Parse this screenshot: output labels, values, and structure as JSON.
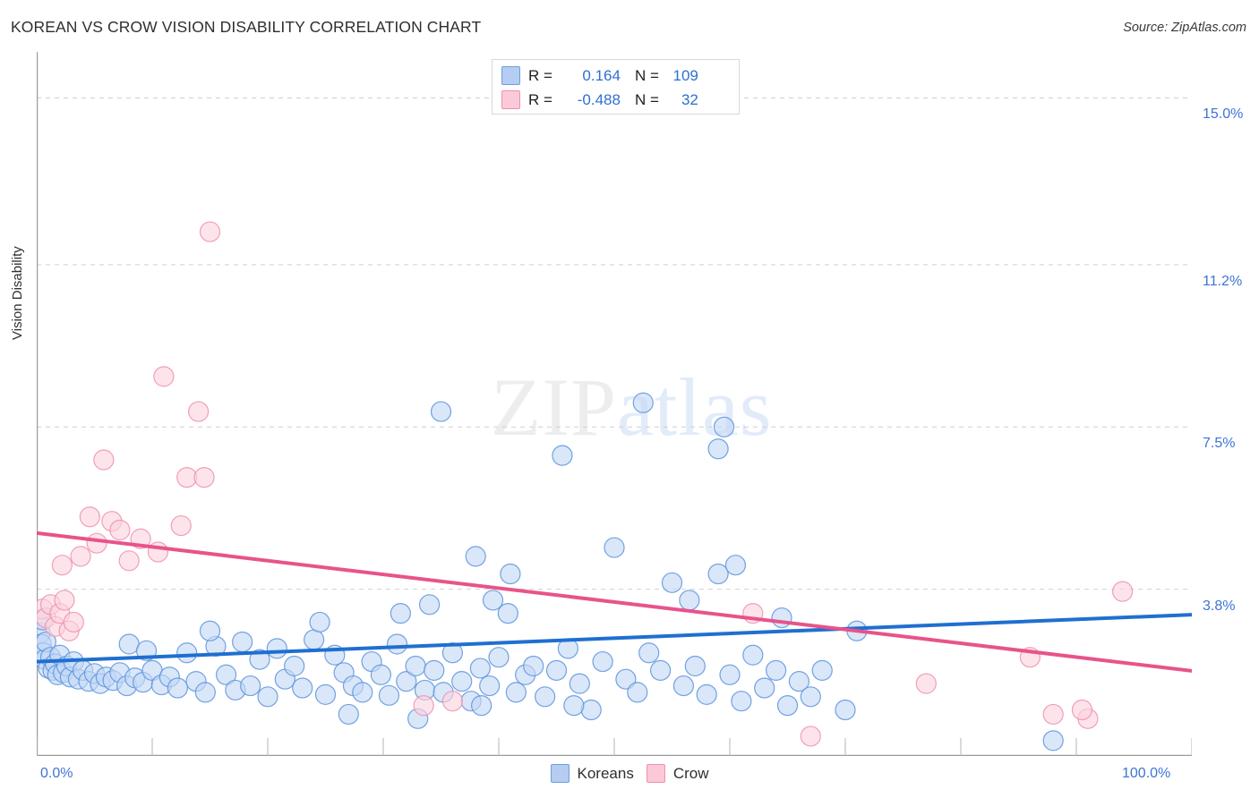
{
  "header": {
    "title": "KOREAN VS CROW VISION DISABILITY CORRELATION CHART",
    "source": "Source: ZipAtlas.com"
  },
  "watermark": {
    "part1": "ZIP",
    "part2": "atlas"
  },
  "stats_legend": {
    "rows": [
      {
        "series": "Koreans",
        "r_label": "R =",
        "r_value": "0.164",
        "n_label": "N =",
        "n_value": "109",
        "color": "#b5cdf0"
      },
      {
        "series": "Crow",
        "r_label": "R =",
        "r_value": "-0.488",
        "n_label": "N =",
        "n_value": "32",
        "color": "#fbc9d8"
      }
    ]
  },
  "bottom_legend": {
    "items": [
      {
        "label": "Koreans",
        "color": "#b5cdf0",
        "border": "#6f9de0"
      },
      {
        "label": "Crow",
        "color": "#fbc9d8",
        "border": "#ee91ad"
      }
    ]
  },
  "chart_data": {
    "type": "scatter",
    "title": "KOREAN VS CROW VISION DISABILITY CORRELATION CHART",
    "xlabel": "",
    "ylabel": "Vision Disability",
    "xlim": [
      0,
      100
    ],
    "ylim": [
      0,
      16.05
    ],
    "grid": true,
    "legend_position": "bottom-center",
    "x_tick_labels": [
      "0.0%",
      "100.0%"
    ],
    "y_tick_labels": [
      "3.8%",
      "7.5%",
      "11.2%",
      "15.0%"
    ],
    "y_tick_values": [
      3.8,
      7.5,
      11.2,
      15.0
    ],
    "series": [
      {
        "name": "Koreans",
        "color": "#c3d9f5",
        "edge": "#5b93dd",
        "r": 0.164,
        "n": 109,
        "trendline": {
          "x0": 0,
          "y0": 2.15,
          "x1": 100,
          "y1": 3.22,
          "color": "#1f6fd0"
        },
        "points": [
          [
            0.3,
            2.8
          ],
          [
            0.4,
            2.55
          ],
          [
            0.5,
            3.1
          ],
          [
            0.6,
            2.35
          ],
          [
            0.7,
            2.2
          ],
          [
            0.8,
            2.6
          ],
          [
            1.0,
            2.0
          ],
          [
            1.2,
            2.25
          ],
          [
            1.4,
            1.95
          ],
          [
            1.6,
            2.1
          ],
          [
            1.8,
            1.85
          ],
          [
            2.0,
            2.3
          ],
          [
            2.3,
            1.9
          ],
          [
            2.6,
            2.05
          ],
          [
            2.9,
            1.8
          ],
          [
            3.2,
            2.15
          ],
          [
            3.6,
            1.75
          ],
          [
            4.0,
            1.95
          ],
          [
            4.5,
            1.7
          ],
          [
            5.0,
            1.88
          ],
          [
            5.5,
            1.65
          ],
          [
            6.0,
            1.8
          ],
          [
            6.6,
            1.72
          ],
          [
            7.2,
            1.9
          ],
          [
            7.8,
            1.6
          ],
          [
            8.5,
            1.78
          ],
          [
            9.2,
            1.68
          ],
          [
            10.0,
            1.95
          ],
          [
            10.8,
            1.62
          ],
          [
            8.0,
            2.55
          ],
          [
            9.5,
            2.4
          ],
          [
            11.5,
            1.8
          ],
          [
            12.2,
            1.55
          ],
          [
            13.0,
            2.35
          ],
          [
            13.8,
            1.7
          ],
          [
            14.6,
            1.45
          ],
          [
            15.5,
            2.5
          ],
          [
            16.4,
            1.85
          ],
          [
            17.2,
            1.5
          ],
          [
            15.0,
            2.85
          ],
          [
            17.8,
            2.6
          ],
          [
            18.5,
            1.6
          ],
          [
            19.3,
            2.2
          ],
          [
            20.0,
            1.35
          ],
          [
            20.8,
            2.45
          ],
          [
            21.5,
            1.75
          ],
          [
            22.3,
            2.05
          ],
          [
            23.0,
            1.55
          ],
          [
            24.0,
            2.65
          ],
          [
            25.0,
            1.4
          ],
          [
            25.8,
            2.3
          ],
          [
            26.6,
            1.9
          ],
          [
            27.4,
            1.6
          ],
          [
            24.5,
            3.05
          ],
          [
            28.2,
            1.45
          ],
          [
            29.0,
            2.15
          ],
          [
            29.8,
            1.85
          ],
          [
            30.5,
            1.38
          ],
          [
            31.2,
            2.55
          ],
          [
            27.0,
            0.95
          ],
          [
            32.0,
            1.7
          ],
          [
            32.8,
            2.05
          ],
          [
            33.6,
            1.5
          ],
          [
            34.4,
            1.95
          ],
          [
            31.5,
            3.25
          ],
          [
            35.2,
            1.45
          ],
          [
            36.0,
            2.35
          ],
          [
            36.8,
            1.7
          ],
          [
            33.0,
            0.85
          ],
          [
            37.6,
            1.25
          ],
          [
            38.4,
            2.0
          ],
          [
            34.0,
            3.45
          ],
          [
            35.0,
            7.85
          ],
          [
            39.2,
            1.6
          ],
          [
            40.0,
            2.25
          ],
          [
            40.8,
            3.25
          ],
          [
            41.5,
            1.45
          ],
          [
            38.0,
            4.55
          ],
          [
            42.3,
            1.85
          ],
          [
            43.0,
            2.05
          ],
          [
            39.5,
            3.55
          ],
          [
            44.0,
            1.35
          ],
          [
            45.0,
            1.95
          ],
          [
            41.0,
            4.15
          ],
          [
            46.0,
            2.45
          ],
          [
            47.0,
            1.65
          ],
          [
            38.5,
            1.15
          ],
          [
            48.0,
            1.05
          ],
          [
            49.0,
            2.15
          ],
          [
            50.0,
            4.75
          ],
          [
            51.0,
            1.75
          ],
          [
            45.5,
            6.85
          ],
          [
            52.0,
            1.45
          ],
          [
            53.0,
            2.35
          ],
          [
            54.0,
            1.95
          ],
          [
            46.5,
            1.15
          ],
          [
            55.0,
            3.95
          ],
          [
            56.0,
            1.6
          ],
          [
            57.0,
            2.05
          ],
          [
            52.5,
            8.05
          ],
          [
            58.0,
            1.4
          ],
          [
            59.0,
            4.15
          ],
          [
            60.0,
            1.85
          ],
          [
            61.0,
            1.25
          ],
          [
            62.0,
            2.3
          ],
          [
            63.0,
            1.55
          ],
          [
            56.5,
            3.55
          ],
          [
            64.0,
            1.95
          ],
          [
            65.0,
            1.15
          ],
          [
            59.5,
            7.5
          ],
          [
            59.0,
            7.0
          ],
          [
            66.0,
            1.7
          ],
          [
            67.0,
            1.35
          ],
          [
            60.5,
            4.35
          ],
          [
            64.5,
            3.15
          ],
          [
            68.0,
            1.95
          ],
          [
            70.0,
            1.05
          ],
          [
            71.0,
            2.85
          ],
          [
            88.0,
            0.35
          ]
        ]
      },
      {
        "name": "Crow",
        "color": "#fcd3de",
        "edge": "#ef8fae",
        "r": -0.488,
        "n": 32,
        "trendline": {
          "x0": 0,
          "y0": 5.08,
          "x1": 100,
          "y1": 1.94,
          "color": "#e8538a"
        },
        "points": [
          [
            0.5,
            3.35
          ],
          [
            0.8,
            3.15
          ],
          [
            1.2,
            3.45
          ],
          [
            1.6,
            2.95
          ],
          [
            2.0,
            3.25
          ],
          [
            2.4,
            3.55
          ],
          [
            2.8,
            2.85
          ],
          [
            3.2,
            3.05
          ],
          [
            2.2,
            4.35
          ],
          [
            3.8,
            4.55
          ],
          [
            4.6,
            5.45
          ],
          [
            5.2,
            4.85
          ],
          [
            5.8,
            6.75
          ],
          [
            6.5,
            5.35
          ],
          [
            7.2,
            5.15
          ],
          [
            8.0,
            4.45
          ],
          [
            9.0,
            4.95
          ],
          [
            10.5,
            4.65
          ],
          [
            11.0,
            8.65
          ],
          [
            12.5,
            5.25
          ],
          [
            14.0,
            7.85
          ],
          [
            15.0,
            11.95
          ],
          [
            13.0,
            6.35
          ],
          [
            14.5,
            6.35
          ],
          [
            33.5,
            1.15
          ],
          [
            36.0,
            1.25
          ],
          [
            62.0,
            3.25
          ],
          [
            67.0,
            0.45
          ],
          [
            77.0,
            1.65
          ],
          [
            86.0,
            2.25
          ],
          [
            88.0,
            0.95
          ],
          [
            91.0,
            0.85
          ],
          [
            94.0,
            3.75
          ],
          [
            90.5,
            1.05
          ]
        ]
      }
    ]
  },
  "axis": {
    "y_labels": [
      {
        "text": "15.0%",
        "value": 15.0
      },
      {
        "text": "11.2%",
        "value": 11.2
      },
      {
        "text": "7.5%",
        "value": 7.5
      },
      {
        "text": "3.8%",
        "value": 3.8
      }
    ],
    "x_labels": [
      {
        "text": "0.0%",
        "value": 0
      },
      {
        "text": "100.0%",
        "value": 100
      }
    ]
  }
}
